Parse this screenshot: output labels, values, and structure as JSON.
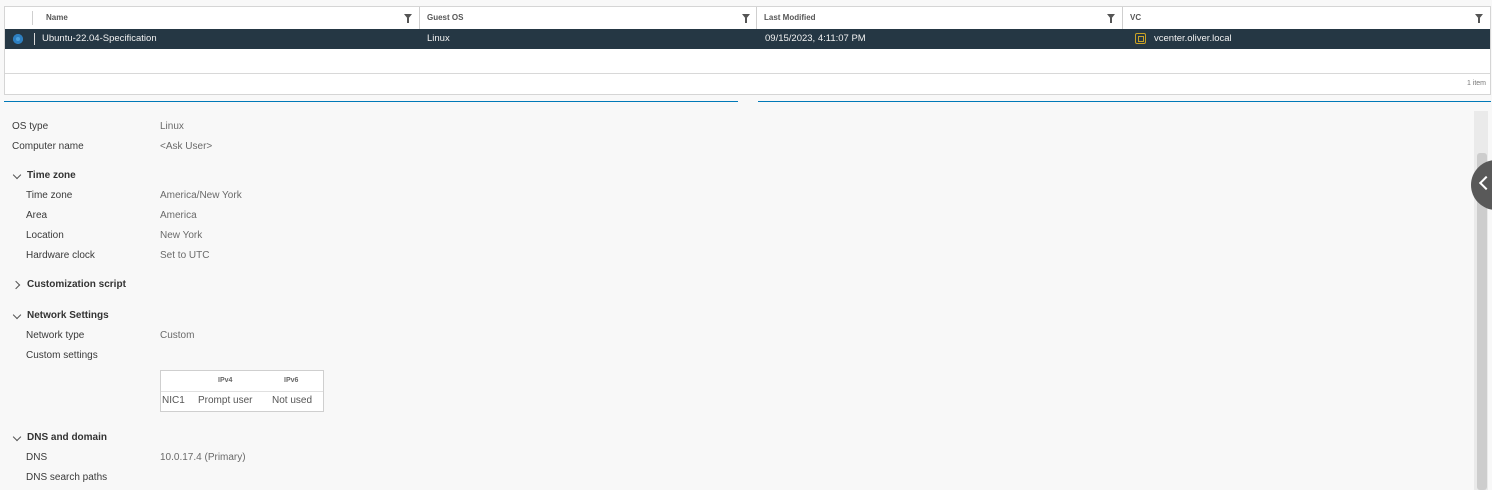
{
  "grid": {
    "columns": [
      {
        "label": "Name"
      },
      {
        "label": "Guest OS"
      },
      {
        "label": "Last Modified"
      },
      {
        "label": "VC"
      }
    ],
    "rows": [
      {
        "name": "Ubuntu-22.04-Specification",
        "guest_os": "Linux",
        "last_modified": "09/15/2023, 4:11:07 PM",
        "vc": "vcenter.oliver.local",
        "selected": true
      }
    ],
    "footer_count": "1 item"
  },
  "details": {
    "os_type_label": "OS type",
    "os_type_value": "Linux",
    "computer_name_label": "Computer name",
    "computer_name_value": "<Ask User>",
    "time_zone_section": {
      "title": "Time zone",
      "expanded": true,
      "rows": [
        {
          "label": "Time zone",
          "value": "America/New York"
        },
        {
          "label": "Area",
          "value": "America"
        },
        {
          "label": "Location",
          "value": "New York"
        },
        {
          "label": "Hardware clock",
          "value": "Set to UTC"
        }
      ]
    },
    "customization_script_section": {
      "title": "Customization script",
      "expanded": false
    },
    "network_section": {
      "title": "Network Settings",
      "expanded": true,
      "network_type_label": "Network type",
      "network_type_value": "Custom",
      "custom_settings_label": "Custom settings",
      "nic_table": {
        "headers": [
          "IPv4",
          "IPv6"
        ],
        "rows": [
          {
            "nic": "NIC1",
            "ipv4": "Prompt user",
            "ipv6": "Not used"
          }
        ]
      }
    },
    "dns_section": {
      "title": "DNS and domain",
      "expanded": true,
      "dns_label": "DNS",
      "dns_value": "10.0.17.4 (Primary)",
      "dns_search_paths_label": "DNS search paths"
    }
  },
  "colors": {
    "selected_row_bg": "#253744",
    "accent": "#0079b8",
    "vc_icon": "#c9a227"
  },
  "icons": [
    "filter-icon",
    "radio-selected-icon",
    "vcenter-icon",
    "chevron-down-icon",
    "chevron-right-icon",
    "collapse-panel-icon"
  ]
}
